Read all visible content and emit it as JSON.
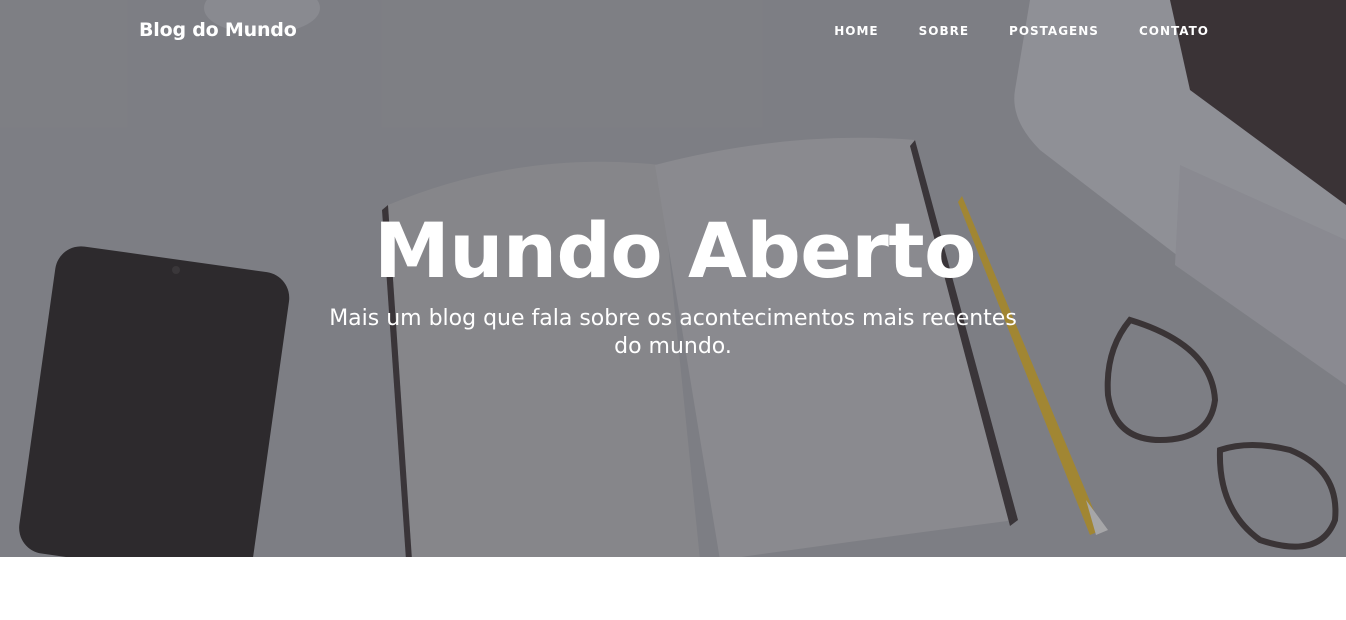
{
  "navbar": {
    "brand": "Blog do Mundo",
    "links": [
      {
        "label": "HOME"
      },
      {
        "label": "SOBRE"
      },
      {
        "label": "POSTAGENS"
      },
      {
        "label": "CONTATO"
      }
    ]
  },
  "hero": {
    "title": "Mundo Aberto",
    "subtitle": "Mais um blog que fala sobre os acontecimentos mais recentes do mundo."
  },
  "colors": {
    "hero_background": "#8a8b90",
    "text": "#ffffff",
    "page_background": "#ffffff"
  }
}
